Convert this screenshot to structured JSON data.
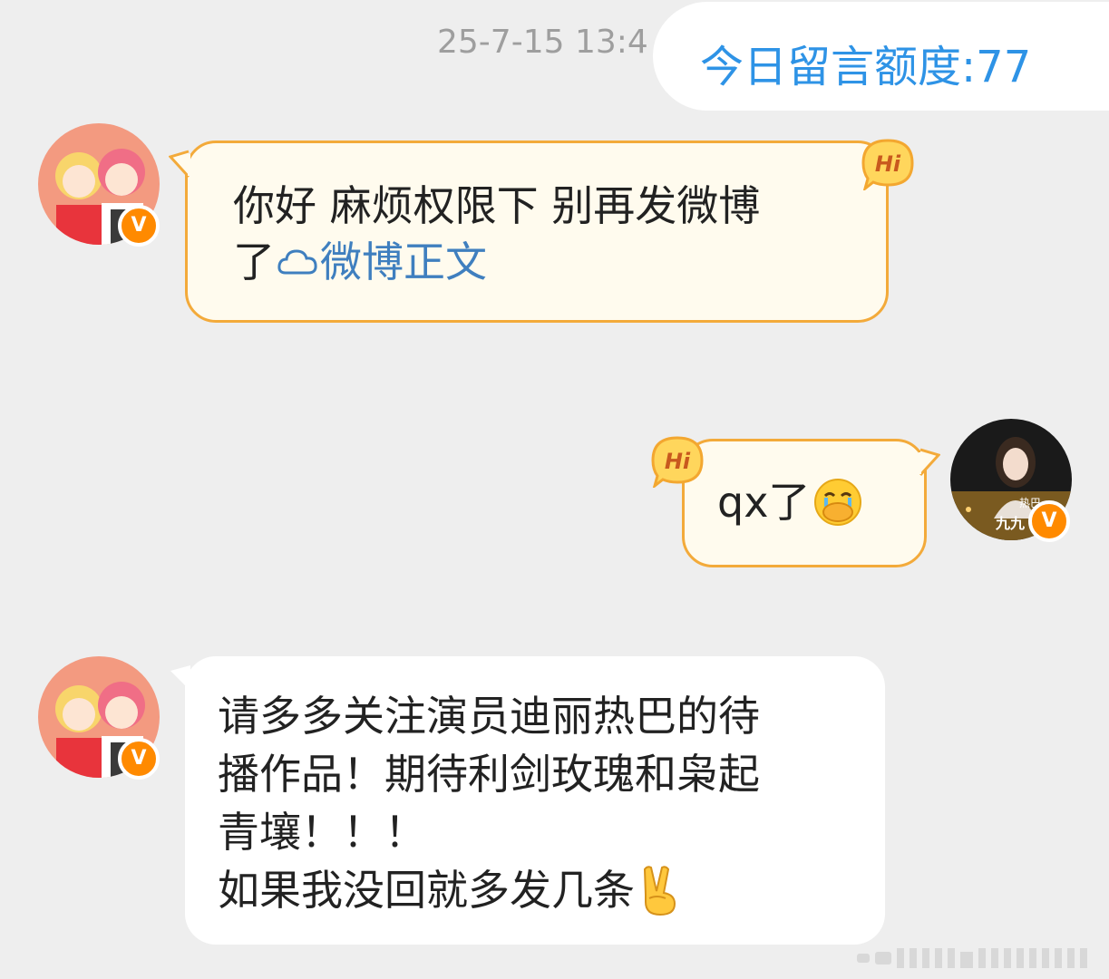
{
  "header": {
    "timestamp": "25-7-15 13:4",
    "quota_label": "今日留言额度:77"
  },
  "messages": [
    {
      "side": "left",
      "hi_tag": "Hi",
      "text_line1": "你好 麻烦权限下 别再发微博",
      "text_line2_prefix": "了",
      "link_label": "微博正文",
      "link_icon": "weibo-cloud-icon"
    },
    {
      "side": "right",
      "hi_tag": "Hi",
      "text": "qx了",
      "emoji": "crying-covering-mouth-emoji"
    },
    {
      "side": "left",
      "lines": [
        "请多多关注演员迪丽热巴的待",
        "播作品！期待利剑玫瑰和枭起",
        "青壤！！！",
        "如果我没回就多发几条"
      ],
      "emoji": "victory-hand-emoji"
    }
  ],
  "avatars": {
    "badge": "V",
    "right_avatar_caption": "九九",
    "right_avatar_top_text": "热巴"
  },
  "colors": {
    "background": "#eeeeee",
    "quota_blue": "#2e93e6",
    "hi_border": "#f3aa3a",
    "hi_bubble_bg": "#fffbee",
    "link_blue": "#3f7fbf",
    "badge_orange": "#ff8a00"
  }
}
